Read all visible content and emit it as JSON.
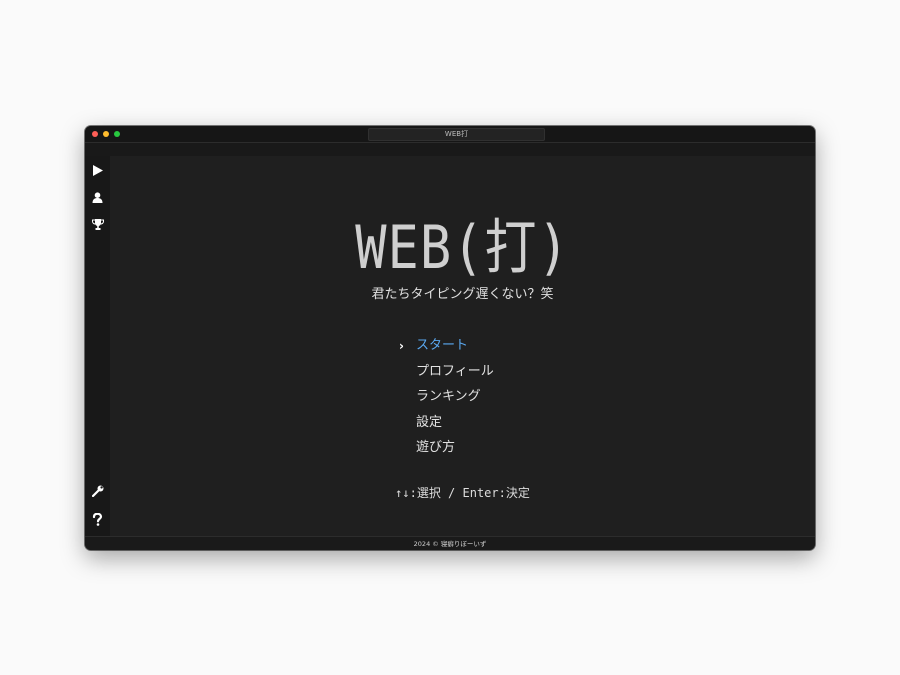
{
  "window": {
    "title": "WEB打"
  },
  "sidebar": {
    "top_icons": [
      "play-icon",
      "user-icon",
      "trophy-icon"
    ],
    "bottom_icons": [
      "wrench-icon",
      "help-icon"
    ]
  },
  "main": {
    "logo": "WEB(打)",
    "tagline": "君たちタイピング遅くない？笑",
    "menu": {
      "cursor": "›",
      "items": [
        {
          "label": "スタート",
          "selected": true
        },
        {
          "label": "プロフィール",
          "selected": false
        },
        {
          "label": "ランキング",
          "selected": false
        },
        {
          "label": "設定",
          "selected": false
        },
        {
          "label": "遊び方",
          "selected": false
        }
      ]
    },
    "hint": "↑↓:選択 / Enter:決定"
  },
  "footer": {
    "text": "2024 © 寝癖りぼーいず"
  },
  "colors": {
    "selected": "#5aa8f0",
    "background": "#1f1f1f"
  }
}
